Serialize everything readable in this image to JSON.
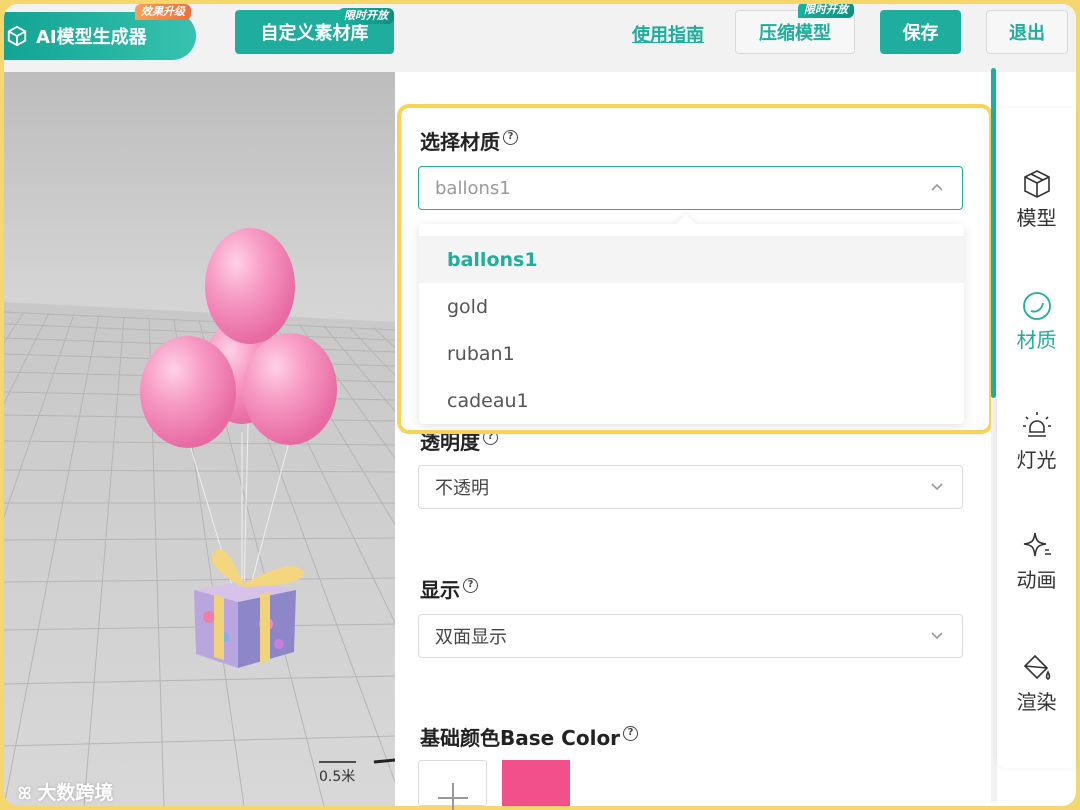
{
  "topbar": {
    "ai_generator_label": "AI模型生成器",
    "ai_badge": "效果升级",
    "material_lib_label": "自定义素材库",
    "material_lib_badge": "限时开放",
    "guide_link": "使用指南",
    "compress_label": "压缩模型",
    "compress_badge": "限时开放",
    "save_label": "保存",
    "exit_label": "退出"
  },
  "viewport": {
    "scale_label": "0.5米",
    "watermark": "大数跨境"
  },
  "panel": {
    "material": {
      "label": "选择材质",
      "selected": "ballons1",
      "options": [
        "ballons1",
        "gold",
        "ruban1",
        "cadeau1"
      ]
    },
    "transparency": {
      "label": "透明度",
      "value": "不透明"
    },
    "display": {
      "label": "显示",
      "value": "双面显示"
    },
    "base_color": {
      "label": "基础颜色Base Color",
      "swatch_color": "#f2508a"
    }
  },
  "sidebar": {
    "items": [
      {
        "label": "模型",
        "icon": "cube-icon"
      },
      {
        "label": "材质",
        "icon": "material-icon"
      },
      {
        "label": "灯光",
        "icon": "lightbulb-icon"
      },
      {
        "label": "动画",
        "icon": "sparkle-icon"
      },
      {
        "label": "渲染",
        "icon": "paint-bucket-icon"
      }
    ],
    "active": "材质"
  },
  "colors": {
    "accent": "#1fae9e",
    "highlight_border": "#f7d458",
    "frame_background": "#f5d76e"
  }
}
